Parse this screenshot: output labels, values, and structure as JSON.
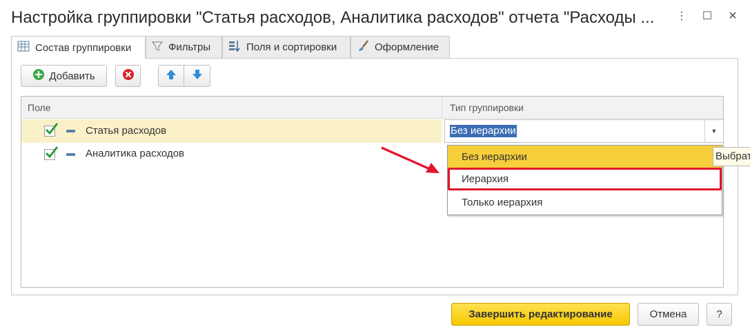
{
  "window": {
    "title": "Настройка группировки \"Статья расходов, Аналитика расходов\" отчета \"Расходы ...",
    "more_glyph": "⋮",
    "maximize_glyph": "☐",
    "close_glyph": "✕"
  },
  "tabs": [
    {
      "label": "Состав группировки",
      "icon": "table-icon",
      "active": true
    },
    {
      "label": "Фильтры",
      "icon": "filter-icon",
      "active": false
    },
    {
      "label": "Поля и сортировки",
      "icon": "fields-sort-icon",
      "active": false
    },
    {
      "label": "Оформление",
      "icon": "brush-icon",
      "active": false
    }
  ],
  "toolbar": {
    "add_label": "Добавить",
    "icons": [
      "add-icon",
      "delete-icon",
      "arrow-up-icon",
      "arrow-down-icon"
    ]
  },
  "table": {
    "headers": {
      "field": "Поле",
      "group_type": "Тип группировки"
    },
    "rows": [
      {
        "checked": true,
        "label": "Статья расходов",
        "group_type": "Без иерархии",
        "selected": true
      },
      {
        "checked": true,
        "label": "Аналитика расходов",
        "group_type": "",
        "selected": false
      }
    ]
  },
  "dropdown": {
    "options": [
      "Без иерархии",
      "Иерархия",
      "Только иерархия"
    ],
    "selected_index": 0,
    "highlighted_index": 1,
    "tooltip": "Выбрать"
  },
  "footer": {
    "finish_label": "Завершить редактирование",
    "cancel_label": "Отмена",
    "help_label": "?"
  },
  "colors": {
    "accent_yellow": "#f5c800",
    "selection_blue": "#3b6db5",
    "highlight_red": "#e3142a",
    "row_highlight": "#fbf1c9",
    "check_green": "#1f9b3a"
  }
}
